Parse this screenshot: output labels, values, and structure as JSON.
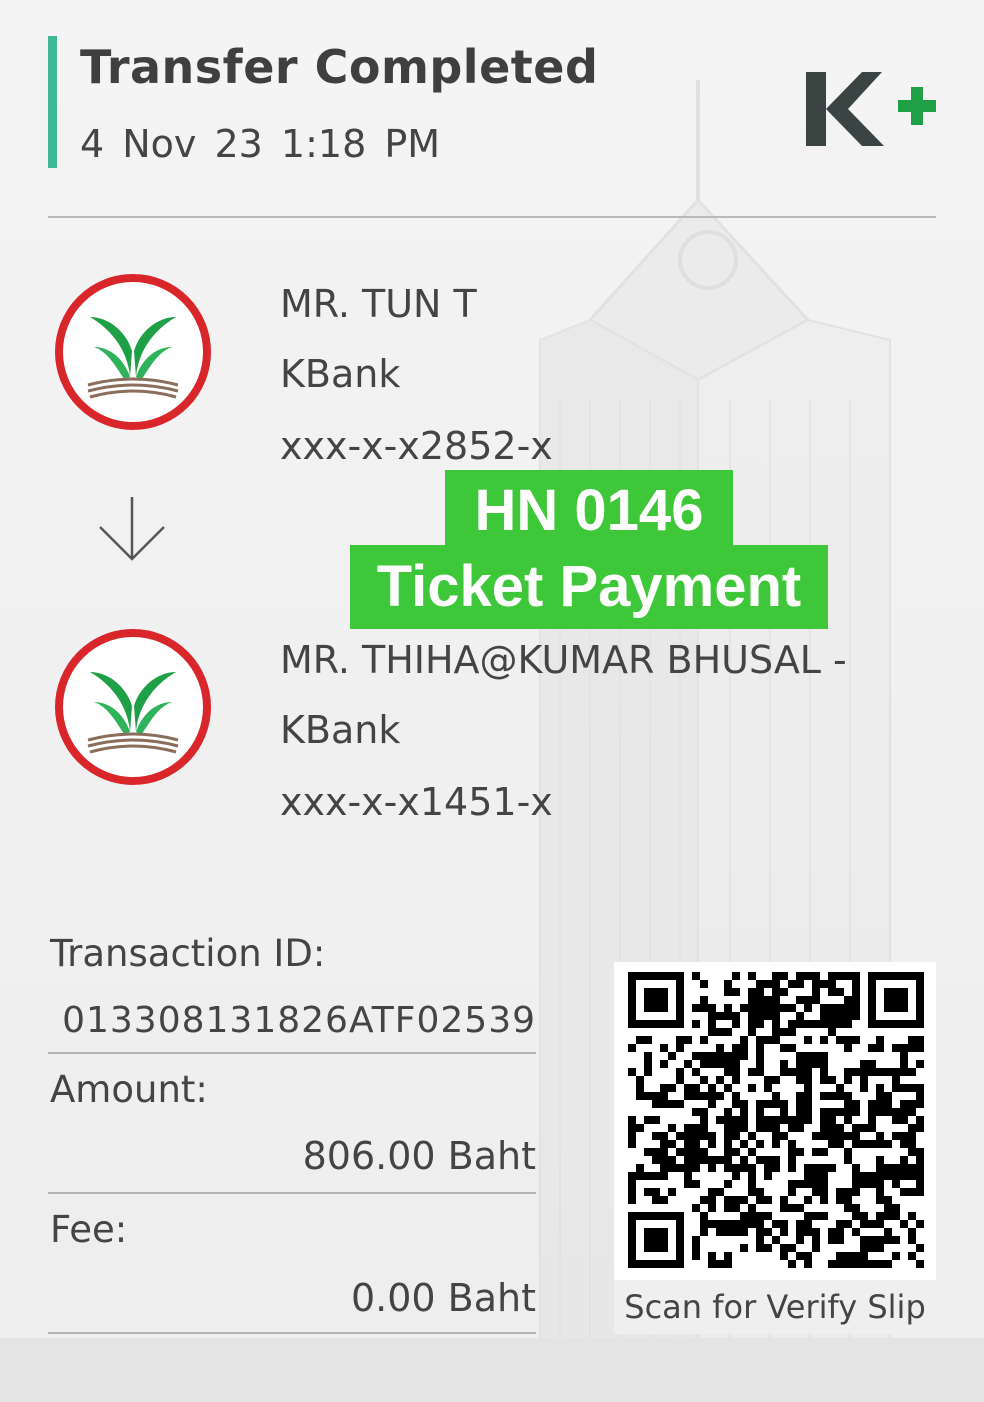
{
  "header": {
    "title": "Transfer Completed",
    "datetime": "4 Nov 23  1:18 PM",
    "logo_text": "K+"
  },
  "sender": {
    "name": "MR. TUN T",
    "bank": "KBank",
    "account": "xxx-x-x2852-x",
    "logo_icon": "kbank-logo-icon"
  },
  "receiver": {
    "name": "MR. THIHA@KUMAR BHUSAL -",
    "bank": "KBank",
    "account": "xxx-x-x1451-x",
    "logo_icon": "kbank-logo-icon"
  },
  "overlay": {
    "line1": "HN 0146",
    "line2": "Ticket Payment",
    "color": "#3fc73a"
  },
  "details": {
    "transaction_id_label": "Transaction ID:",
    "transaction_id": "013308131826ATF02539",
    "amount_label": "Amount:",
    "amount": "806.00 Baht",
    "fee_label": "Fee:",
    "fee": "0.00 Baht"
  },
  "qr": {
    "caption": "Scan for Verify Slip"
  },
  "colors": {
    "accent": "#3fb896",
    "kbank_green": "#1fa046",
    "kbank_red": "#d9262b",
    "logo_dark": "#3a4443"
  }
}
